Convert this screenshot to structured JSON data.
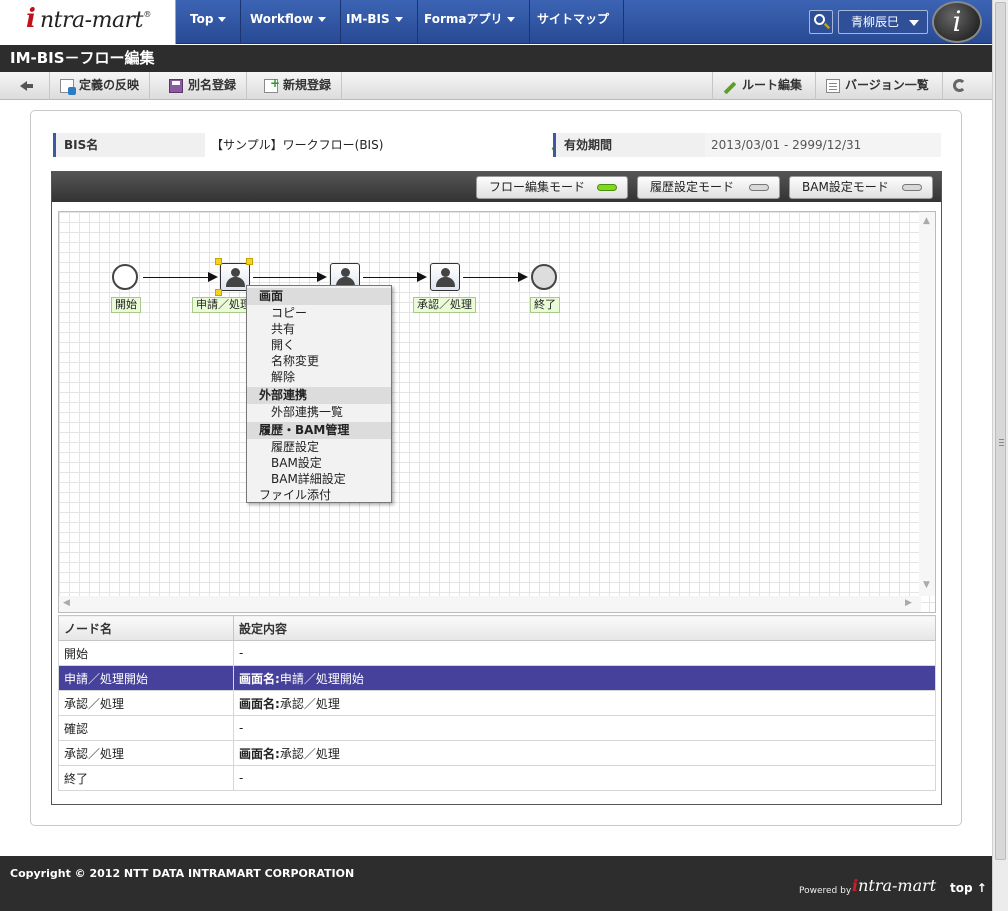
{
  "brand": {
    "logo_i": "i",
    "logo_text": "ntra-mart",
    "logo_reg": "®"
  },
  "nav": [
    {
      "label": "Top",
      "dropdown": true
    },
    {
      "label": "Workflow",
      "dropdown": true
    },
    {
      "label": "IM-BIS",
      "dropdown": true
    },
    {
      "label": "Formaアプリ",
      "dropdown": true
    },
    {
      "label": "サイトマップ",
      "dropdown": false
    }
  ],
  "user": {
    "name": "青柳辰巳"
  },
  "i_badge": "i",
  "page_title": "IM-BIS－フロー編集",
  "toolbar": {
    "back": "",
    "apply": "定義の反映",
    "save_as": "別名登録",
    "new": "新規登録",
    "route_edit": "ルート編集",
    "version_list": "バージョン一覧"
  },
  "info": {
    "bis_name_label": "BIS名",
    "bis_name_value": "【サンプル】ワークフロー(BIS)",
    "period_label": "有効期間",
    "period_value": "2013/03/01 - 2999/12/31"
  },
  "modes": [
    {
      "label": "フロー編集モード",
      "active": true
    },
    {
      "label": "履歴設定モード",
      "active": false
    },
    {
      "label": "BAM設定モード",
      "active": false
    }
  ],
  "nodes": {
    "start": "開始",
    "apply": "申請／処理",
    "approve": "承認／処理",
    "end": "終了"
  },
  "context_menu": {
    "screen_head": "画面",
    "screen_items": [
      "コピー",
      "共有",
      "開く",
      "名称変更",
      "解除"
    ],
    "ext_head": "外部連携",
    "ext_items": [
      "外部連携一覧"
    ],
    "hist_head": "履歴・BAM管理",
    "hist_items": [
      "履歴設定",
      "BAM設定",
      "BAM詳細設定"
    ],
    "attach": "ファイル添付"
  },
  "table": {
    "headers": [
      "ノード名",
      "設定内容"
    ],
    "rows": [
      {
        "name": "開始",
        "prefix": "",
        "value": "-",
        "selected": false
      },
      {
        "name": "申請／処理開始",
        "prefix": "画面名:",
        "value": "申請／処理開始",
        "selected": true
      },
      {
        "name": "承認／処理",
        "prefix": "画面名:",
        "value": "承認／処理",
        "selected": false
      },
      {
        "name": "確認",
        "prefix": "",
        "value": "-",
        "selected": false
      },
      {
        "name": "承認／処理",
        "prefix": "画面名:",
        "value": "承認／処理",
        "selected": false
      },
      {
        "name": "終了",
        "prefix": "",
        "value": "-",
        "selected": false
      }
    ]
  },
  "footer": {
    "copyright": "Copyright © 2012 NTT DATA INTRAMART CORPORATION",
    "powered": "Powered by",
    "logo_i": "i",
    "logo_text": "ntra-mart",
    "top_link": "top ↑"
  },
  "colors": {
    "nav_bg": "#2f57a8",
    "selected_row": "#46419a",
    "led_on": "#7ddb1e"
  }
}
